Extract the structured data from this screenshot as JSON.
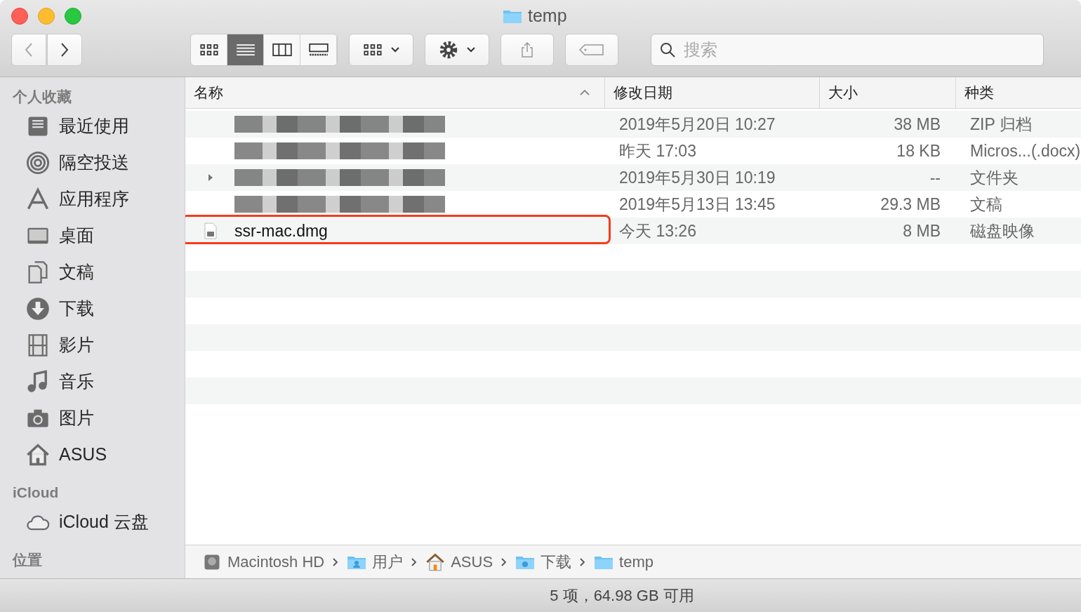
{
  "window": {
    "title": "temp"
  },
  "toolbar": {
    "view_modes": [
      {
        "kind": "icons",
        "selected": false
      },
      {
        "kind": "list",
        "selected": true
      },
      {
        "kind": "columns",
        "selected": false
      },
      {
        "kind": "gallery",
        "selected": false
      }
    ],
    "search": {
      "placeholder": "搜索"
    }
  },
  "sidebar": {
    "sections": [
      {
        "title": "个人收藏",
        "items": [
          {
            "label": "最近使用",
            "kind": "recents"
          },
          {
            "label": "隔空投送",
            "kind": "airdrop"
          },
          {
            "label": "应用程序",
            "kind": "apps"
          },
          {
            "label": "桌面",
            "kind": "desktop"
          },
          {
            "label": "文稿",
            "kind": "documents"
          },
          {
            "label": "下载",
            "kind": "downloads"
          },
          {
            "label": "影片",
            "kind": "movies"
          },
          {
            "label": "音乐",
            "kind": "music"
          },
          {
            "label": "图片",
            "kind": "pictures"
          },
          {
            "label": "ASUS",
            "kind": "home"
          }
        ]
      },
      {
        "title": "iCloud",
        "items": [
          {
            "label": "iCloud 云盘",
            "kind": "cloud"
          }
        ]
      },
      {
        "title": "位置"
      }
    ]
  },
  "table": {
    "columns": [
      "名称",
      "修改日期",
      "大小",
      "种类"
    ],
    "rows": [
      {
        "name_redacted": true,
        "kind": "file",
        "date": "2019年5月20日 10:27",
        "size": "38 MB",
        "type": "ZIP 归档",
        "highlighted": false
      },
      {
        "name_redacted": true,
        "kind": "file",
        "date": "昨天 17:03",
        "size": "18 KB",
        "type": "Micros...(.docx)",
        "highlighted": false
      },
      {
        "name_redacted": true,
        "kind": "folder",
        "date": "2019年5月30日 10:19",
        "size": "--",
        "type": "文件夹",
        "highlighted": false
      },
      {
        "name_redacted": true,
        "kind": "file",
        "date": "2019年5月13日 13:45",
        "size": "29.3 MB",
        "type": "文稿",
        "highlighted": false
      },
      {
        "name": "ssr-mac.dmg",
        "name_redacted": false,
        "kind": "disk",
        "date": "今天 13:26",
        "size": "8 MB",
        "type": "磁盘映像",
        "highlighted": true
      }
    ]
  },
  "path_bar": [
    {
      "label": "Macintosh HD",
      "kind": "disk"
    },
    {
      "label": "用户",
      "kind": "users"
    },
    {
      "label": "ASUS",
      "kind": "home"
    },
    {
      "label": "下载",
      "kind": "downloads"
    },
    {
      "label": "temp",
      "kind": "folder"
    }
  ],
  "status_bar": "5 项，64.98 GB 可用"
}
